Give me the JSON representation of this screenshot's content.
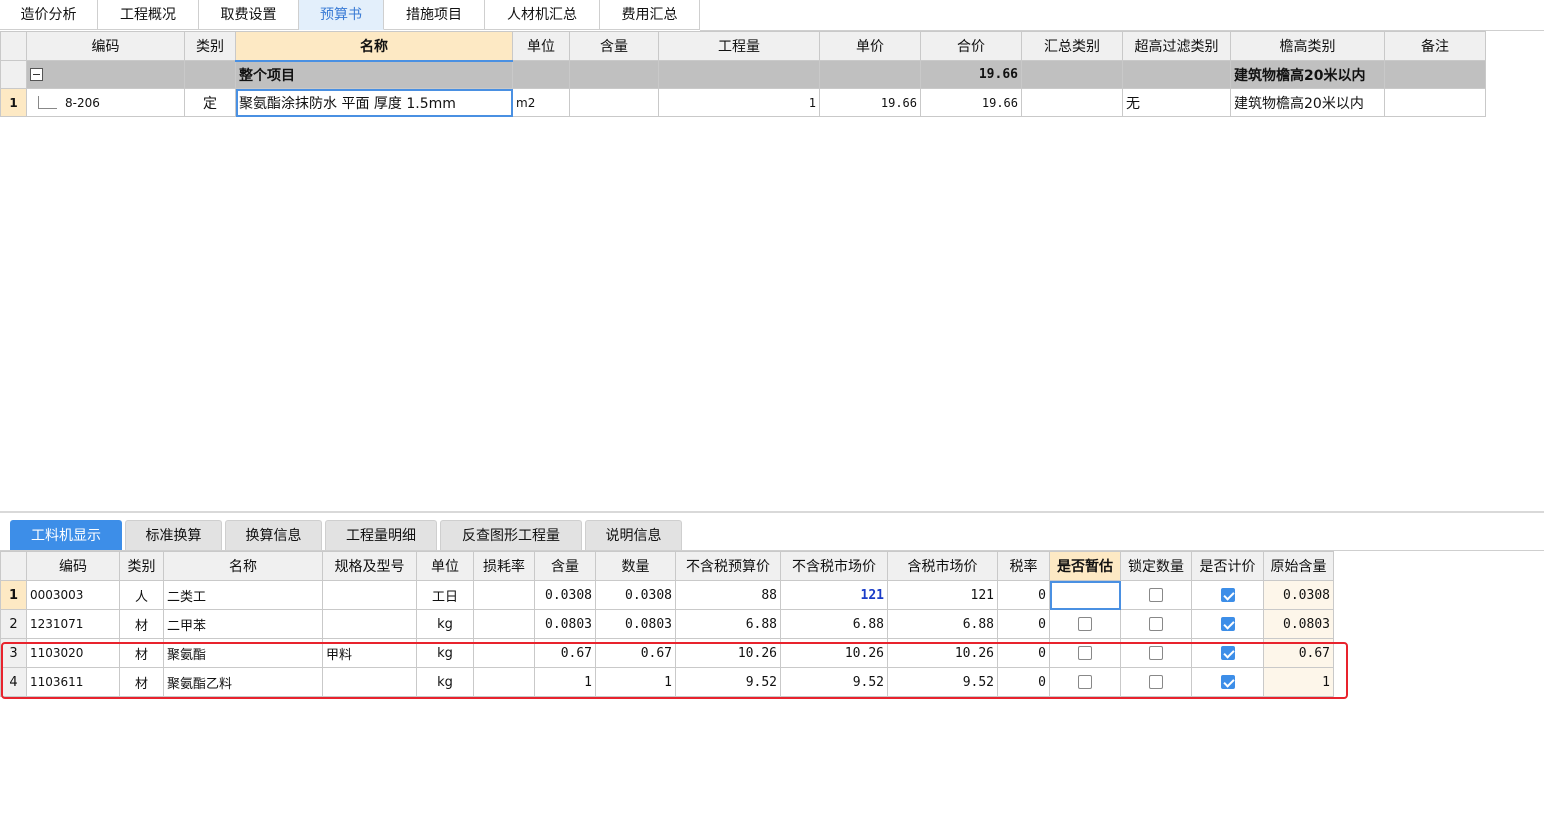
{
  "top_tabs": [
    {
      "label": "造价分析",
      "active": false
    },
    {
      "label": "工程概况",
      "active": false
    },
    {
      "label": "取费设置",
      "active": false
    },
    {
      "label": "预算书",
      "active": true
    },
    {
      "label": "措施项目",
      "active": false
    },
    {
      "label": "人材机汇总",
      "active": false
    },
    {
      "label": "费用汇总",
      "active": false
    }
  ],
  "main_grid": {
    "headers": [
      "编码",
      "类别",
      "名称",
      "单位",
      "含量",
      "工程量",
      "单价",
      "合价",
      "汇总类别",
      "超高过滤类别",
      "檐高类别",
      "备注"
    ],
    "group_row": {
      "name": "整个项目",
      "total": "19.66",
      "eave": "建筑物檐高20米以内"
    },
    "rows": [
      {
        "no": "1",
        "code": "8-206",
        "type": "定",
        "name": "聚氨酯涂抹防水 平面 厚度 1.5mm",
        "unit": "m2",
        "content": "",
        "qty": "1",
        "price": "19.66",
        "total": "19.66",
        "sum_cat": "",
        "filter": "无",
        "eave": "建筑物檐高20米以内",
        "remark": ""
      }
    ]
  },
  "bottom_tabs": [
    {
      "label": "工料机显示",
      "active": true
    },
    {
      "label": "标准换算",
      "active": false
    },
    {
      "label": "换算信息",
      "active": false
    },
    {
      "label": "工程量明细",
      "active": false
    },
    {
      "label": "反查图形工程量",
      "active": false
    },
    {
      "label": "说明信息",
      "active": false
    }
  ],
  "detail_grid": {
    "headers": [
      "编码",
      "类别",
      "名称",
      "规格及型号",
      "单位",
      "损耗率",
      "含量",
      "数量",
      "不含税预算价",
      "不含税市场价",
      "含税市场价",
      "税率",
      "是否暂估",
      "锁定数量",
      "是否计价",
      "原始含量"
    ],
    "rows": [
      {
        "no": "1",
        "code": "0003003",
        "type": "人",
        "name": "二类工",
        "spec": "",
        "unit": "工日",
        "loss": "",
        "content": "0.0308",
        "qty": "0.0308",
        "budget": "88",
        "market": "121",
        "market_tax": "121",
        "tax": "0",
        "est": false,
        "lock": false,
        "priced": true,
        "orig": "0.0308"
      },
      {
        "no": "2",
        "code": "1231071",
        "type": "材",
        "name": "二甲苯",
        "spec": "",
        "unit": "kg",
        "loss": "",
        "content": "0.0803",
        "qty": "0.0803",
        "budget": "6.88",
        "market": "6.88",
        "market_tax": "6.88",
        "tax": "0",
        "est": false,
        "lock": false,
        "priced": true,
        "orig": "0.0803"
      },
      {
        "no": "3",
        "code": "1103020",
        "type": "材",
        "name": "聚氨酯",
        "spec": "甲料",
        "unit": "kg",
        "loss": "",
        "content": "0.67",
        "qty": "0.67",
        "budget": "10.26",
        "market": "10.26",
        "market_tax": "10.26",
        "tax": "0",
        "est": false,
        "lock": false,
        "priced": true,
        "orig": "0.67"
      },
      {
        "no": "4",
        "code": "1103611",
        "type": "材",
        "name": "聚氨酯乙料",
        "spec": "",
        "unit": "kg",
        "loss": "",
        "content": "1",
        "qty": "1",
        "budget": "9.52",
        "market": "9.52",
        "market_tax": "9.52",
        "tax": "0",
        "est": false,
        "lock": false,
        "priced": true,
        "orig": "1"
      }
    ]
  },
  "colors": {
    "accent": "#3d8ee8",
    "highlight": "#e8232d",
    "header_selected": "#fde9c4"
  }
}
